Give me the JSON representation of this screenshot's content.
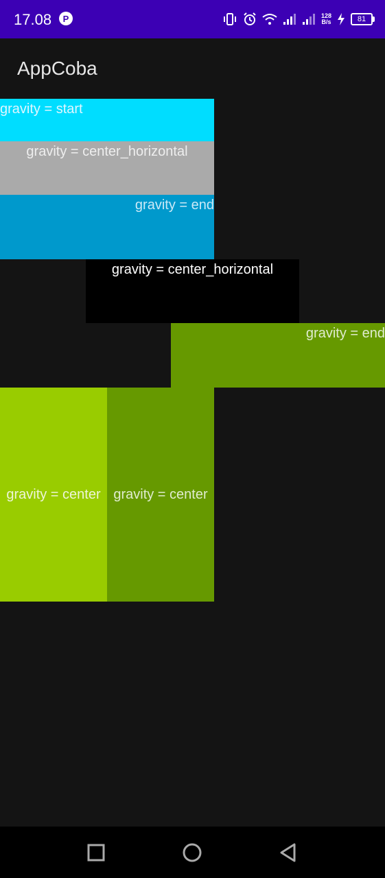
{
  "status_bar": {
    "time": "17.08",
    "app_badge": "P",
    "net_speed_value": "128",
    "net_speed_unit": "B/s",
    "battery_level": "81",
    "icons": [
      "vibrate-icon",
      "alarm-icon",
      "wifi-icon",
      "signal-icon",
      "signal-icon",
      "charging-icon"
    ]
  },
  "app_bar": {
    "title": "AppCoba"
  },
  "views": [
    {
      "label": "gravity = start",
      "background": "#00ddff",
      "text_color": "#dff6ff"
    },
    {
      "label": "gravity = center_horizontal",
      "background": "#aaaaaa",
      "text_color": "#eeeeee"
    },
    {
      "label": "gravity = end",
      "background": "#0099cc",
      "text_color": "#cbe9f7"
    },
    {
      "label": "gravity = center_horizontal",
      "background": "#000000",
      "text_color": "#ffffff"
    },
    {
      "label": "gravity = end",
      "background": "#669900",
      "text_color": "#e0ecd0"
    },
    {
      "label": "gravity = center",
      "background": "#99cc00",
      "text_color": "#eef5d9"
    },
    {
      "label": "gravity = center",
      "background": "#669900",
      "text_color": "#e0ecd0"
    }
  ],
  "nav_bar": {
    "buttons": [
      "recents-icon",
      "home-icon",
      "back-icon"
    ]
  },
  "colors": {
    "status_bar": "#3c00b4",
    "app_background": "#141414",
    "nav_bar": "#000000"
  }
}
